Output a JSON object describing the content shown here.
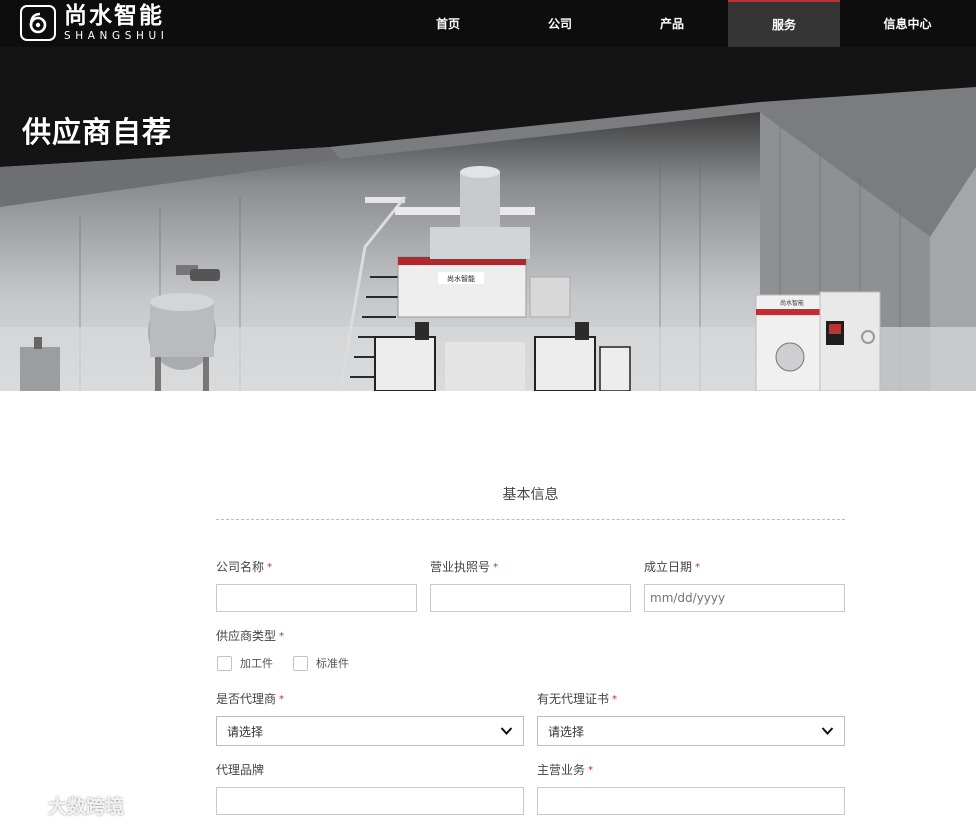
{
  "header": {
    "logo_cn": "尚水智能",
    "logo_en": "SHANGSHUI",
    "nav": [
      {
        "label": "首页",
        "active": false
      },
      {
        "label": "公司",
        "active": false
      },
      {
        "label": "产品",
        "active": false
      },
      {
        "label": "服务",
        "active": true
      },
      {
        "label": "信息中心",
        "active": false
      }
    ]
  },
  "hero": {
    "title": "供应商自荐",
    "machine_badge_a": "尚水智能",
    "machine_badge_b": "尚水智能"
  },
  "form": {
    "section_title": "基本信息",
    "required_mark": "*",
    "fields": {
      "company_name": {
        "label": "公司名称",
        "value": ""
      },
      "license_no": {
        "label": "营业执照号",
        "value": ""
      },
      "founded_date": {
        "label": "成立日期",
        "placeholder": "mm/dd/yyyy"
      },
      "supplier_type": {
        "label": "供应商类型",
        "options": [
          "加工件",
          "标准件"
        ]
      },
      "is_agent": {
        "label": "是否代理商",
        "selected": "请选择"
      },
      "agent_cert": {
        "label": "有无代理证书",
        "selected": "请选择"
      },
      "agent_brand": {
        "label": "代理品牌",
        "value": ""
      },
      "main_business": {
        "label": "主营业务",
        "value": ""
      }
    }
  },
  "watermark": {
    "text": "大数跨境"
  },
  "colors": {
    "header_bg": "#0d0d0d",
    "accent": "#d0282f",
    "active_nav": "#353535"
  }
}
